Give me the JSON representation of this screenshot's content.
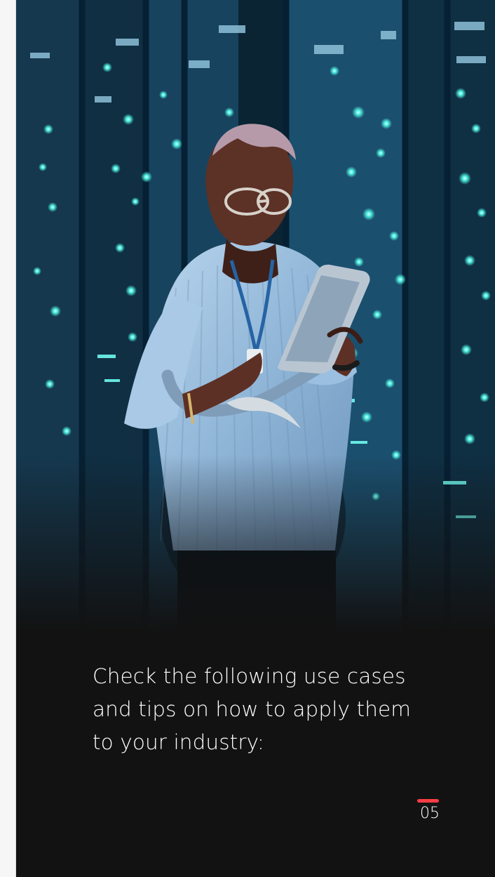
{
  "document": {
    "body_text": "Check the following use cases\nand tips on how to apply them\nto your industry:",
    "page_number": "05"
  },
  "colors": {
    "accent": "#ff3d45",
    "page_background": "#121212",
    "outer_background": "#f6f6f6"
  },
  "icons": {
    "page_marker": "red-bar"
  }
}
